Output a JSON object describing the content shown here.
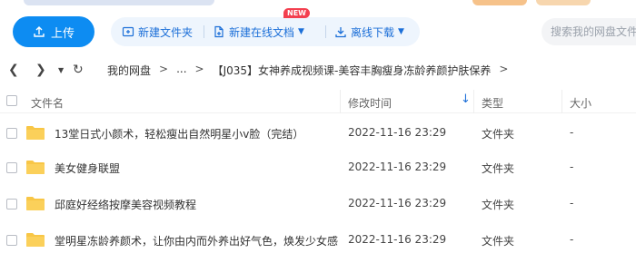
{
  "toolbar": {
    "upload_label": "上传",
    "new_folder_label": "新建文件夹",
    "new_online_doc_label": "新建在线文档",
    "new_badge": "NEW",
    "offline_download_label": "离线下载",
    "search_placeholder": "搜索我的网盘文件"
  },
  "breadcrumb": {
    "root": "我的网盘",
    "sep1": ">",
    "ellipsis": "...",
    "sep2": ">",
    "current": "【J035】女神养成视频课-美容丰胸瘦身冻龄养颜护肤保养",
    "sep3": ">"
  },
  "columns": {
    "name": "文件名",
    "modified": "修改时间",
    "type": "类型",
    "size": "大小"
  },
  "files": [
    {
      "name": "13堂日式小颜术，轻松瘦出自然明星小v脸（完结）",
      "modified": "2022-11-16 23:29",
      "type": "文件夹",
      "size": "-"
    },
    {
      "name": "美女健身联盟",
      "modified": "2022-11-16 23:29",
      "type": "文件夹",
      "size": "-"
    },
    {
      "name": "邱庭好经络按摩美容视频教程",
      "modified": "2022-11-16 23:29",
      "type": "文件夹",
      "size": "-"
    },
    {
      "name": "堂明星冻龄养颜术，让你由内而外养出好气色，焕发少女感",
      "modified": "2022-11-16 23:29",
      "type": "文件夹",
      "size": "-"
    }
  ],
  "colors": {
    "accent": "#0d8cf2",
    "link": "#1c6fd8",
    "folder": "#f8c646",
    "badge": "#f33f4f"
  }
}
